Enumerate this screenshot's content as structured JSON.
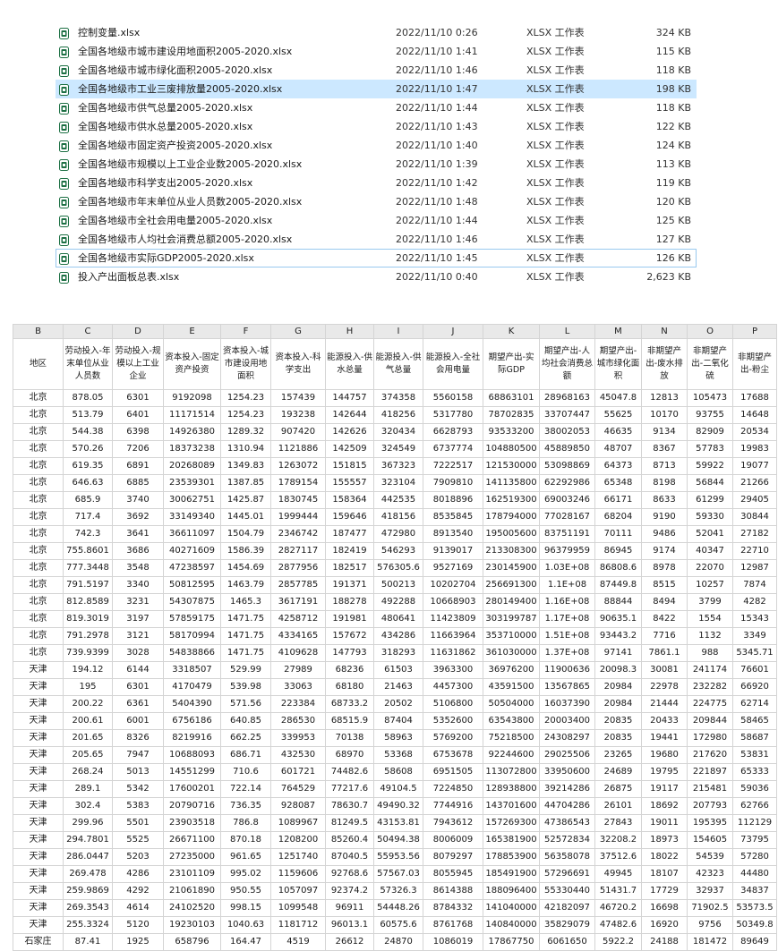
{
  "files": [
    {
      "name": "控制变量.xlsx",
      "date": "2022/11/10 0:26",
      "type": "XLSX 工作表",
      "size": "324 KB",
      "state": ""
    },
    {
      "name": "全国各地级市城市建设用地面积2005-2020.xlsx",
      "date": "2022/11/10 1:41",
      "type": "XLSX 工作表",
      "size": "115 KB",
      "state": ""
    },
    {
      "name": "全国各地级市城市绿化面积2005-2020.xlsx",
      "date": "2022/11/10 1:46",
      "type": "XLSX 工作表",
      "size": "118 KB",
      "state": ""
    },
    {
      "name": "全国各地级市工业三废排放量2005-2020.xlsx",
      "date": "2022/11/10 1:47",
      "type": "XLSX 工作表",
      "size": "198 KB",
      "state": "sel"
    },
    {
      "name": "全国各地级市供气总量2005-2020.xlsx",
      "date": "2022/11/10 1:44",
      "type": "XLSX 工作表",
      "size": "118 KB",
      "state": ""
    },
    {
      "name": "全国各地级市供水总量2005-2020.xlsx",
      "date": "2022/11/10 1:43",
      "type": "XLSX 工作表",
      "size": "122 KB",
      "state": ""
    },
    {
      "name": "全国各地级市固定资产投资2005-2020.xlsx",
      "date": "2022/11/10 1:40",
      "type": "XLSX 工作表",
      "size": "124 KB",
      "state": ""
    },
    {
      "name": "全国各地级市规模以上工业企业数2005-2020.xlsx",
      "date": "2022/11/10 1:39",
      "type": "XLSX 工作表",
      "size": "113 KB",
      "state": ""
    },
    {
      "name": "全国各地级市科学支出2005-2020.xlsx",
      "date": "2022/11/10 1:42",
      "type": "XLSX 工作表",
      "size": "119 KB",
      "state": ""
    },
    {
      "name": "全国各地级市年末单位从业人员数2005-2020.xlsx",
      "date": "2022/11/10 1:48",
      "type": "XLSX 工作表",
      "size": "120 KB",
      "state": ""
    },
    {
      "name": "全国各地级市全社会用电量2005-2020.xlsx",
      "date": "2022/11/10 1:44",
      "type": "XLSX 工作表",
      "size": "125 KB",
      "state": ""
    },
    {
      "name": "全国各地级市人均社会消费总额2005-2020.xlsx",
      "date": "2022/11/10 1:46",
      "type": "XLSX 工作表",
      "size": "127 KB",
      "state": ""
    },
    {
      "name": "全国各地级市实际GDP2005-2020.xlsx",
      "date": "2022/11/10 1:45",
      "type": "XLSX 工作表",
      "size": "126 KB",
      "state": "focus"
    },
    {
      "name": "投入产出面板总表.xlsx",
      "date": "2022/11/10 0:40",
      "type": "XLSX 工作表",
      "size": "2,623 KB",
      "state": ""
    }
  ],
  "sheet": {
    "col_letters": [
      "B",
      "C",
      "D",
      "E",
      "F",
      "G",
      "H",
      "I",
      "J",
      "K",
      "L",
      "M",
      "N",
      "O",
      "P"
    ],
    "headers": [
      "地区",
      "劳动投入-年末单位从业人员数",
      "劳动投入-规模以上工业企业",
      "资本投入-固定资产投资",
      "资本投入-城市建设用地面积",
      "资本投入-科学支出",
      "能源投入-供水总量",
      "能源投入-供气总量",
      "能源投入-全社会用电量",
      "期望产出-实际GDP",
      "期望产出-人均社会消费总额",
      "期望产出-城市绿化面积",
      "非期望产出-废水排放",
      "非期望产出-二氧化硫",
      "非期望产出-粉尘"
    ],
    "rows": [
      [
        "北京",
        "878.05",
        "6301",
        "9192098",
        "1254.23",
        "157439",
        "144757",
        "374358",
        "5560158",
        "68863101",
        "28968163",
        "45047.8",
        "12813",
        "105473",
        "17688"
      ],
      [
        "北京",
        "513.79",
        "6401",
        "11171514",
        "1254.23",
        "193238",
        "142644",
        "418256",
        "5317780",
        "78702835",
        "33707447",
        "55625",
        "10170",
        "93755",
        "14648"
      ],
      [
        "北京",
        "544.38",
        "6398",
        "14926380",
        "1289.32",
        "907420",
        "142626",
        "320434",
        "6628793",
        "93533200",
        "38002053",
        "46635",
        "9134",
        "82909",
        "20534"
      ],
      [
        "北京",
        "570.26",
        "7206",
        "18373238",
        "1310.94",
        "1121886",
        "142509",
        "324549",
        "6737774",
        "104880500",
        "45889850",
        "48707",
        "8367",
        "57783",
        "19983"
      ],
      [
        "北京",
        "619.35",
        "6891",
        "20268089",
        "1349.83",
        "1263072",
        "151815",
        "367323",
        "7222517",
        "121530000",
        "53098869",
        "64373",
        "8713",
        "59922",
        "19077"
      ],
      [
        "北京",
        "646.63",
        "6885",
        "23539301",
        "1387.85",
        "1789154",
        "155557",
        "323104",
        "7909810",
        "141135800",
        "62292986",
        "65348",
        "8198",
        "56844",
        "21266"
      ],
      [
        "北京",
        "685.9",
        "3740",
        "30062751",
        "1425.87",
        "1830745",
        "158364",
        "442535",
        "8018896",
        "162519300",
        "69003246",
        "66171",
        "8633",
        "61299",
        "29405"
      ],
      [
        "北京",
        "717.4",
        "3692",
        "33149340",
        "1445.01",
        "1999444",
        "159646",
        "418156",
        "8535845",
        "178794000",
        "77028167",
        "68204",
        "9190",
        "59330",
        "30844"
      ],
      [
        "北京",
        "742.3",
        "3641",
        "36611097",
        "1504.79",
        "2346742",
        "187477",
        "472980",
        "8913540",
        "195005600",
        "83751191",
        "70111",
        "9486",
        "52041",
        "27182"
      ],
      [
        "北京",
        "755.8601",
        "3686",
        "40271609",
        "1586.39",
        "2827117",
        "182419",
        "546293",
        "9139017",
        "213308300",
        "96379959",
        "86945",
        "9174",
        "40347",
        "22710"
      ],
      [
        "北京",
        "777.3448",
        "3548",
        "47238597",
        "1454.69",
        "2877956",
        "182517",
        "576305.6",
        "9527169",
        "230145900",
        "1.03E+08",
        "86808.6",
        "8978",
        "22070",
        "12987"
      ],
      [
        "北京",
        "791.5197",
        "3340",
        "50812595",
        "1463.79",
        "2857785",
        "191371",
        "500213",
        "10202704",
        "256691300",
        "1.1E+08",
        "87449.8",
        "8515",
        "10257",
        "7874"
      ],
      [
        "北京",
        "812.8589",
        "3231",
        "54307875",
        "1465.3",
        "3617191",
        "188278",
        "492288",
        "10668903",
        "280149400",
        "1.16E+08",
        "88844",
        "8494",
        "3799",
        "4282"
      ],
      [
        "北京",
        "819.3019",
        "3197",
        "57859175",
        "1471.75",
        "4258712",
        "191981",
        "480641",
        "11423809",
        "303199787",
        "1.17E+08",
        "90635.1",
        "8422",
        "1554",
        "15343"
      ],
      [
        "北京",
        "791.2978",
        "3121",
        "58170994",
        "1471.75",
        "4334165",
        "157672",
        "434286",
        "11663964",
        "353710000",
        "1.51E+08",
        "93443.2",
        "7716",
        "1132",
        "3349"
      ],
      [
        "北京",
        "739.9399",
        "3028",
        "54838866",
        "1471.75",
        "4109628",
        "147793",
        "318293",
        "11631862",
        "361030000",
        "1.37E+08",
        "97141",
        "7861.1",
        "988",
        "5345.71"
      ],
      [
        "天津",
        "194.12",
        "6144",
        "3318507",
        "529.99",
        "27989",
        "68236",
        "61503",
        "3963300",
        "36976200",
        "11900636",
        "20098.3",
        "30081",
        "241174",
        "76601"
      ],
      [
        "天津",
        "195",
        "6301",
        "4170479",
        "539.98",
        "33063",
        "68180",
        "21463",
        "4457300",
        "43591500",
        "13567865",
        "20984",
        "22978",
        "232282",
        "66920"
      ],
      [
        "天津",
        "200.22",
        "6361",
        "5404390",
        "571.56",
        "223384",
        "68733.2",
        "20502",
        "5106800",
        "50504000",
        "16037390",
        "20984",
        "21444",
        "224775",
        "62714"
      ],
      [
        "天津",
        "200.61",
        "6001",
        "6756186",
        "640.85",
        "286530",
        "68515.9",
        "87404",
        "5352600",
        "63543800",
        "20003400",
        "20835",
        "20433",
        "209844",
        "58465"
      ],
      [
        "天津",
        "201.65",
        "8326",
        "8219916",
        "662.25",
        "339953",
        "70138",
        "58963",
        "5769200",
        "75218500",
        "24308297",
        "20835",
        "19441",
        "172980",
        "58687"
      ],
      [
        "天津",
        "205.65",
        "7947",
        "10688093",
        "686.71",
        "432530",
        "68970",
        "53368",
        "6753678",
        "92244600",
        "29025506",
        "23265",
        "19680",
        "217620",
        "53831"
      ],
      [
        "天津",
        "268.24",
        "5013",
        "14551299",
        "710.6",
        "601721",
        "74482.6",
        "58608",
        "6951505",
        "113072800",
        "33950600",
        "24689",
        "19795",
        "221897",
        "65333"
      ],
      [
        "天津",
        "289.1",
        "5342",
        "17600201",
        "722.14",
        "764529",
        "77217.6",
        "49104.5",
        "7224850",
        "128938800",
        "39214286",
        "26875",
        "19117",
        "215481",
        "59036"
      ],
      [
        "天津",
        "302.4",
        "5383",
        "20790716",
        "736.35",
        "928087",
        "78630.7",
        "49490.32",
        "7744916",
        "143701600",
        "44704286",
        "26101",
        "18692",
        "207793",
        "62766"
      ],
      [
        "天津",
        "299.96",
        "5501",
        "23903518",
        "786.8",
        "1089967",
        "81249.5",
        "43153.81",
        "7943612",
        "157269300",
        "47386543",
        "27843",
        "19011",
        "195395",
        "112129"
      ],
      [
        "天津",
        "294.7801",
        "5525",
        "26671100",
        "870.18",
        "1208200",
        "85260.4",
        "50494.38",
        "8006009",
        "165381900",
        "52572834",
        "32208.2",
        "18973",
        "154605",
        "73795"
      ],
      [
        "天津",
        "286.0447",
        "5203",
        "27235000",
        "961.65",
        "1251740",
        "87040.5",
        "55953.56",
        "8079297",
        "178853900",
        "56358078",
        "37512.6",
        "18022",
        "54539",
        "57280"
      ],
      [
        "天津",
        "269.478",
        "4286",
        "23101109",
        "995.02",
        "1159606",
        "92768.6",
        "57567.03",
        "8055945",
        "185491900",
        "57296691",
        "49945",
        "18107",
        "42323",
        "44480"
      ],
      [
        "天津",
        "259.9869",
        "4292",
        "21061890",
        "950.55",
        "1057097",
        "92374.2",
        "57326.3",
        "8614388",
        "188096400",
        "55330440",
        "51431.7",
        "17729",
        "32937",
        "34837"
      ],
      [
        "天津",
        "269.3543",
        "4614",
        "24102520",
        "998.15",
        "1099548",
        "96911",
        "54448.26",
        "8784332",
        "141040000",
        "42182097",
        "46720.2",
        "16698",
        "71902.5",
        "53573.5"
      ],
      [
        "天津",
        "255.3324",
        "5120",
        "19230103",
        "1040.63",
        "1181712",
        "96013.1",
        "60575.6",
        "8761768",
        "140840000",
        "35829079",
        "47482.6",
        "16920",
        "9756",
        "50349.8"
      ],
      [
        "石家庄",
        "87.41",
        "1925",
        "658796",
        "164.47",
        "4519",
        "26612",
        "24870",
        "1086019",
        "17867750",
        "6061650",
        "5922.2",
        "24188",
        "181472",
        "89649"
      ]
    ]
  },
  "colors": {
    "selected_row": "#cce8ff",
    "excel_icon": "#1d7044",
    "header_bg": "#e9e9e9"
  }
}
